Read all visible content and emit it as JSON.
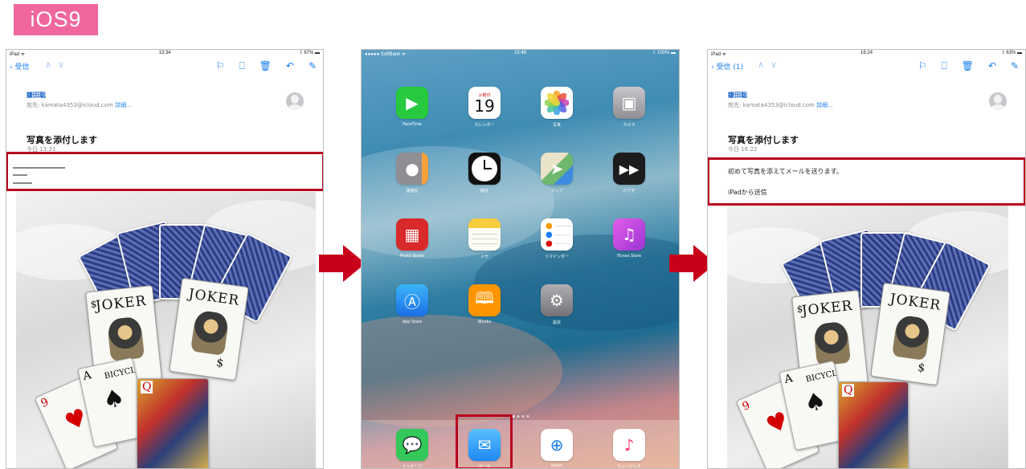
{
  "label": "iOS9",
  "left_screen": {
    "status": {
      "left": "iPad ᯤ",
      "time": "13:34",
      "right": "ᛒ 67% ▬"
    },
    "back_label": "受信",
    "sender": "鎌田聡",
    "to_prefix": "宛先: ",
    "to_address": "kamata4353@icloud.com",
    "to_detail": "詳細...",
    "subject": "写真を添付します",
    "datetime": "今日 13:31"
  },
  "right_screen": {
    "status": {
      "left": "iPad ᯤ",
      "time": "16:24",
      "right": "ᛒ 63% ▬"
    },
    "back_label": "受信 (1)",
    "sender": "鎌田聡",
    "to_prefix": "宛先: ",
    "to_address": "kamata4353@icloud.com",
    "to_detail": "詳細...",
    "subject": "写真を添付します",
    "datetime": "今日 16:22",
    "body_line1": "初めて写真を添えてメールを送ります。",
    "body_line2": "iPadから送信"
  },
  "middle_screen": {
    "status": {
      "left": "●●●●● SoftBank ᯤ",
      "time": "15:48",
      "right": "ᛒ 100% ▬"
    },
    "calendar": {
      "weekday": "火曜日",
      "day": "19"
    },
    "apps": [
      {
        "label": "FaceTime",
        "icon": "facetime-icon",
        "color": "#27c93f"
      },
      {
        "label": "カレンダー",
        "icon": "calendar-icon",
        "color": "#ffffff"
      },
      {
        "label": "写真",
        "icon": "photos-icon",
        "color": "#ffffff"
      },
      {
        "label": "カメラ",
        "icon": "camera-icon",
        "color": "#8e8e93"
      },
      {
        "label": "連絡先",
        "icon": "contacts-icon",
        "color": "#b9b9be"
      },
      {
        "label": "時計",
        "icon": "clock-icon",
        "color": "#111111"
      },
      {
        "label": "マップ",
        "icon": "maps-icon",
        "color": "#6fb76c"
      },
      {
        "label": "ビデオ",
        "icon": "videos-icon",
        "color": "#1c1c1e"
      },
      {
        "label": "Photo Booth",
        "icon": "photo-booth-icon",
        "color": "#d82a2a"
      },
      {
        "label": "メモ",
        "icon": "notes-icon",
        "color": "#fefdf5"
      },
      {
        "label": "リマインダー",
        "icon": "reminders-icon",
        "color": "#ffffff"
      },
      {
        "label": "iTunes Store",
        "icon": "itunes-store-icon",
        "color": "#c33bde"
      },
      {
        "label": "App Store",
        "icon": "app-store-icon",
        "color": "#2a8df3"
      },
      {
        "label": "iBooks",
        "icon": "ibooks-icon",
        "color": "#ff9500"
      },
      {
        "label": "設定",
        "icon": "settings-icon",
        "color": "#8e8e93"
      }
    ],
    "dock": [
      {
        "label": "メッセージ",
        "icon": "messages-icon",
        "color": "#34c759"
      },
      {
        "label": "メール",
        "icon": "mail-icon",
        "color": "#1e88f5"
      },
      {
        "label": "Safari",
        "icon": "safari-icon",
        "color": "#ffffff"
      },
      {
        "label": "ミュージック",
        "icon": "music-icon",
        "color": "#ffffff"
      }
    ]
  },
  "cards": {
    "joker": "JOKER",
    "brand": "BICYCLE",
    "rank_a": "A",
    "rank_9": "9",
    "rank_q": "Q"
  },
  "colors": {
    "badge": "#f0669f",
    "highlight": "#b8001e",
    "arrow": "#c8001a",
    "ios_blue": "#1a7ff0"
  }
}
